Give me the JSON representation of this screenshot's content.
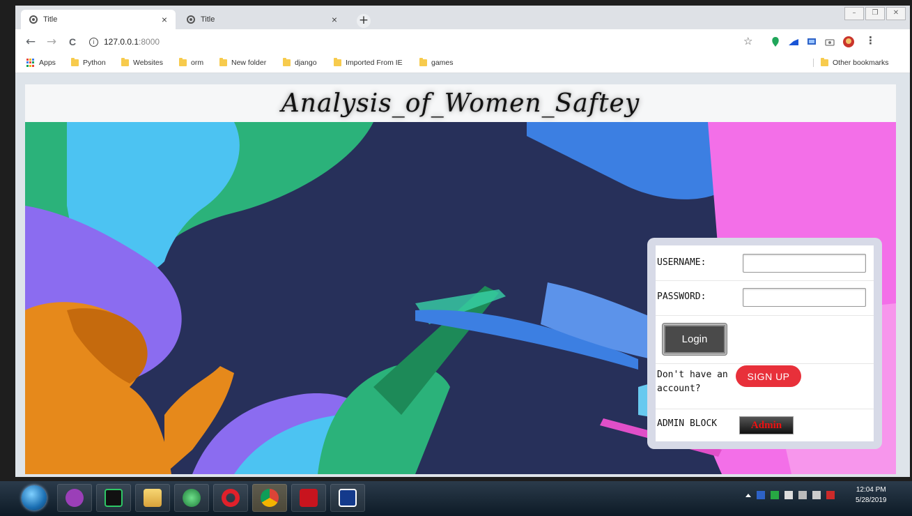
{
  "browser": {
    "tabs": [
      {
        "title": "Title",
        "active": true
      },
      {
        "title": "Title",
        "active": false
      }
    ],
    "new_tab_symbol": "+",
    "close_symbol": "×",
    "address": {
      "host": "127.0.0.1",
      "port": ":8000",
      "info_icon": "i"
    },
    "nav": {
      "back": "←",
      "forward": "→",
      "reload": "C"
    },
    "star": "☆",
    "menu": "⋮",
    "bookmarks": [
      {
        "label": "Apps",
        "icon": "apps-grid-icon"
      },
      {
        "label": "Python",
        "icon": "folder-icon"
      },
      {
        "label": "Websites",
        "icon": "folder-icon"
      },
      {
        "label": "orm",
        "icon": "folder-icon"
      },
      {
        "label": "New folder",
        "icon": "folder-icon"
      },
      {
        "label": "django",
        "icon": "folder-icon"
      },
      {
        "label": "Imported From IE",
        "icon": "folder-icon"
      },
      {
        "label": "games",
        "icon": "folder-icon"
      }
    ],
    "other_bookmarks": "Other bookmarks"
  },
  "page": {
    "title": "Analysis_of_Women_Saftey",
    "login": {
      "username_label": "USERNAME:",
      "username_value": "",
      "password_label": "PASSWORD:",
      "password_value": "",
      "login_button": "Login",
      "signup_prompt": "Don't have an account?",
      "signup_button": "SIGN UP",
      "admin_label": "ADMIN BLOCK",
      "admin_button": "Admin"
    }
  },
  "taskbar": {
    "time": "12:04 PM",
    "date": "5/28/2019",
    "apps": [
      "visual-studio-icon",
      "pycharm-icon",
      "file-explorer-icon",
      "atom-icon",
      "opera-icon",
      "chrome-icon",
      "acrobat-icon",
      "remote-app-icon"
    ]
  },
  "colors": {
    "hero_bg": "#27305a",
    "signup": "#e8303a",
    "admin_text": "#e11111"
  }
}
